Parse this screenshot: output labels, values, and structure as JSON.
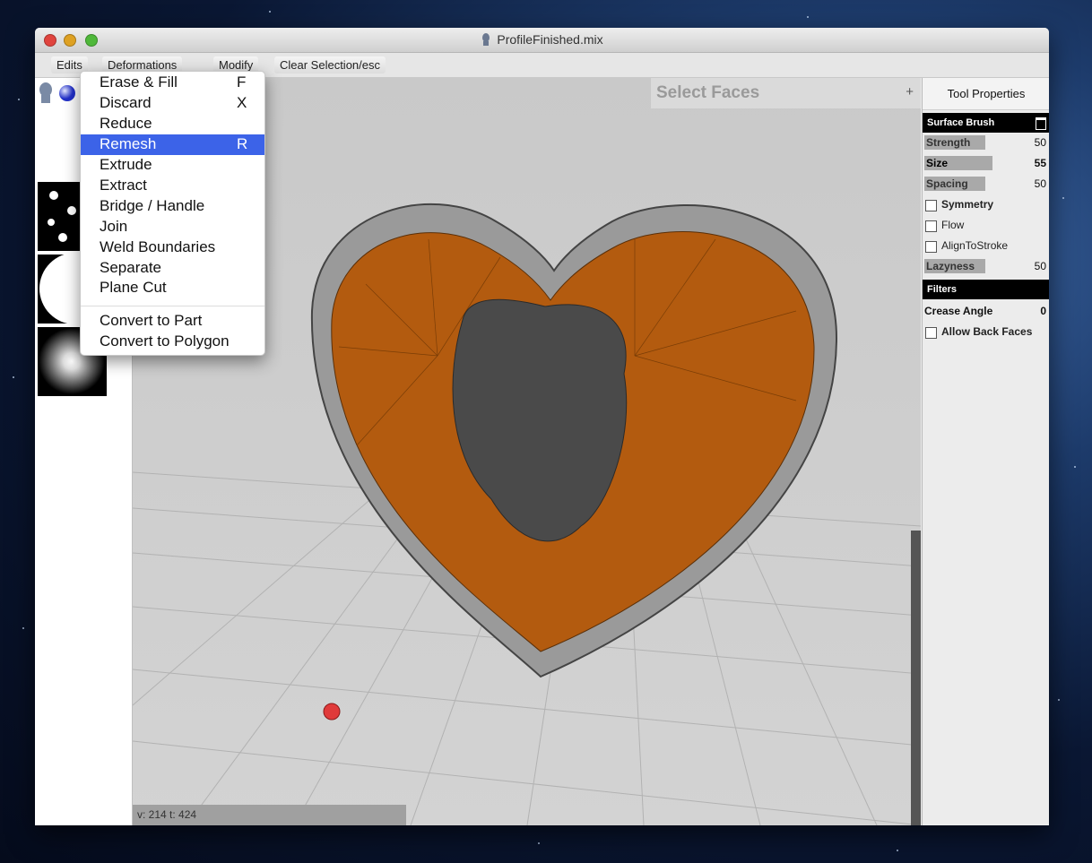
{
  "window": {
    "title": "ProfileFinished.mix"
  },
  "toolbar": {
    "edits_label": "Edits",
    "deformations_label": "Deformations",
    "modify_label": "Modify",
    "clear_selection_label": "Clear Selection/esc"
  },
  "menu": {
    "items": [
      {
        "label": "Erase & Fill",
        "shortcut": "F"
      },
      {
        "label": "Discard",
        "shortcut": "X"
      },
      {
        "label": "Reduce",
        "shortcut": ""
      },
      {
        "label": "Remesh",
        "shortcut": "R",
        "highlighted": true
      },
      {
        "label": "Extrude",
        "shortcut": ""
      },
      {
        "label": "Extract",
        "shortcut": ""
      },
      {
        "label": "Bridge / Handle",
        "shortcut": ""
      },
      {
        "label": "Join",
        "shortcut": ""
      },
      {
        "label": "Weld Boundaries",
        "shortcut": ""
      },
      {
        "label": "Separate",
        "shortcut": ""
      },
      {
        "label": "Plane Cut",
        "shortcut": ""
      },
      {
        "label": "Convert to Part",
        "shortcut": ""
      },
      {
        "label": "Convert to Polygon",
        "shortcut": ""
      }
    ]
  },
  "viewport": {
    "mode_label": "Select Faces",
    "plus_label": "+",
    "status": "v: 214 t: 424"
  },
  "properties": {
    "header": "Tool Properties",
    "section_brush": "Surface Brush",
    "strength_label": "Strength",
    "strength_value": "50",
    "size_label": "Size",
    "size_value": "55",
    "spacing_label": "Spacing",
    "spacing_value": "50",
    "symmetry_label": "Symmetry",
    "flow_label": "Flow",
    "align_label": "AlignToStroke",
    "lazyness_label": "Lazyness",
    "lazyness_value": "50",
    "section_filters": "Filters",
    "crease_label": "Crease Angle",
    "crease_value": "0",
    "back_faces_label": "Allow Back Faces"
  },
  "colors": {
    "accent": "#3c63e8",
    "model_orange": "#b35b0f",
    "background_space": "#0a1733"
  }
}
